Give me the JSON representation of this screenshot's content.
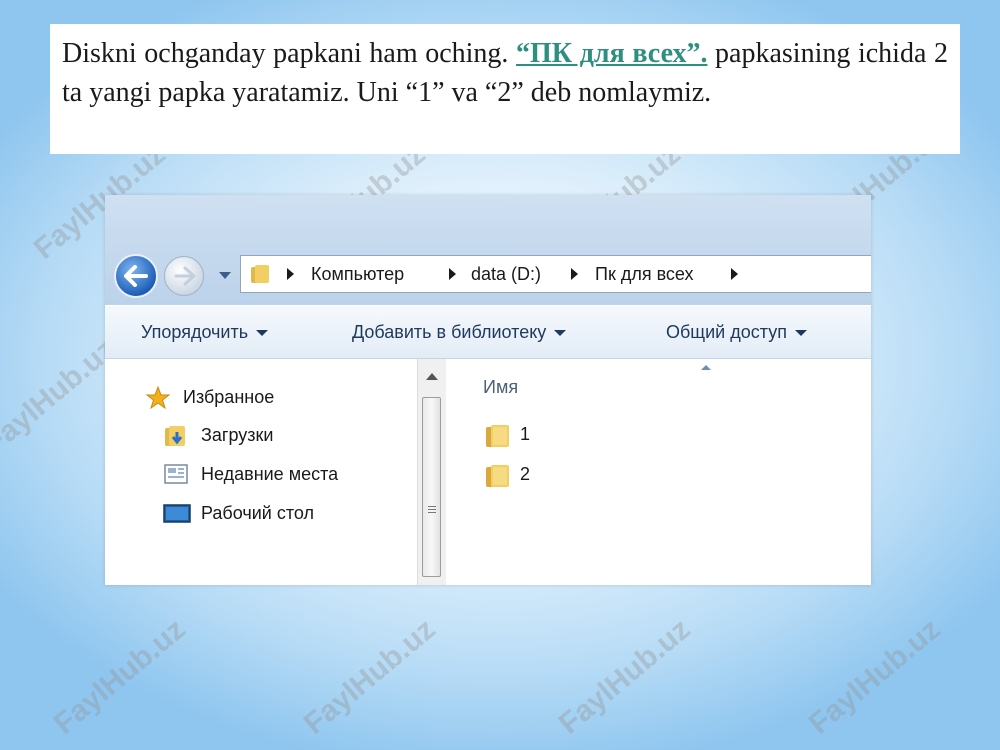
{
  "instruction": {
    "text_before": "Diskni ochganday papkani ham oching. ",
    "highlight": "“ПК для всех”.",
    "text_after": " papkasining ichida 2 ta yangi papka yaratamiz. Uni “1” va “2” deb nomlaymiz."
  },
  "address_bar": {
    "breadcrumbs": [
      "Компьютер",
      "data (D:)",
      "Пк для всех"
    ]
  },
  "toolbar": {
    "organize_label": "Упорядочить",
    "add_library_label": "Добавить в библиотеку",
    "share_label": "Общий доступ"
  },
  "nav_pane": {
    "favorites_label": "Избранное",
    "items": [
      {
        "label": "Загрузки",
        "icon": "downloads-folder-icon"
      },
      {
        "label": "Недавние места",
        "icon": "recent-places-icon"
      },
      {
        "label": "Рабочий стол",
        "icon": "desktop-icon"
      }
    ]
  },
  "file_list": {
    "column_name": "Имя",
    "files": [
      {
        "name": "1",
        "icon": "folder-icon"
      },
      {
        "name": "2",
        "icon": "folder-icon"
      }
    ]
  },
  "watermark": "FaylHub.uz",
  "colors": {
    "highlight": "#2c8f7f",
    "background_edge": "#8fc6ef",
    "toolbar_text": "#1e395b"
  }
}
